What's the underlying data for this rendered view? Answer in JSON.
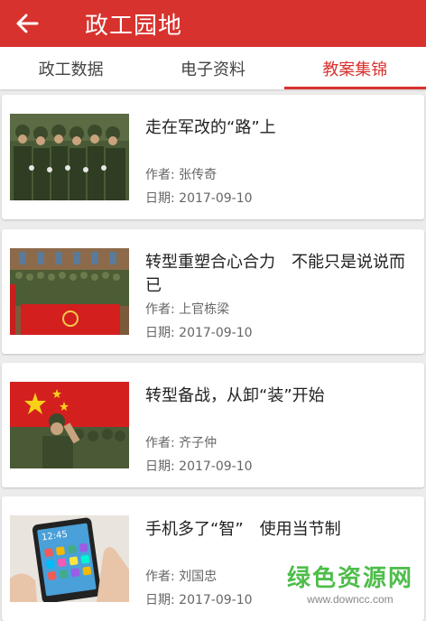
{
  "header": {
    "title": "政工园地",
    "back_icon": "arrow-left-icon"
  },
  "tabs": [
    {
      "label": "政工数据",
      "active": false
    },
    {
      "label": "电子资料",
      "active": false
    },
    {
      "label": "教案集锦",
      "active": true
    }
  ],
  "articles": [
    {
      "title": "走在军改的“路”上",
      "author": "作者: 张传奇",
      "date": "日期: 2017-09-10"
    },
    {
      "title": "转型重塑合心合力　不能只是说说而已",
      "author": "作者: 上官栋梁",
      "date": "日期: 2017-09-10"
    },
    {
      "title": "转型备战，从卸“装”开始",
      "author": "作者: 齐子仲",
      "date": "日期: 2017-09-10"
    },
    {
      "title": "手机多了“智”　使用当节制",
      "author": "作者: 刘国忠",
      "date": "日期: 2017-09-10"
    }
  ],
  "watermark": {
    "main": "绿色资源网",
    "sub": "www.downcc.com"
  },
  "colors": {
    "accent": "#d8322e",
    "watermark_green": "#4fbd4b"
  }
}
